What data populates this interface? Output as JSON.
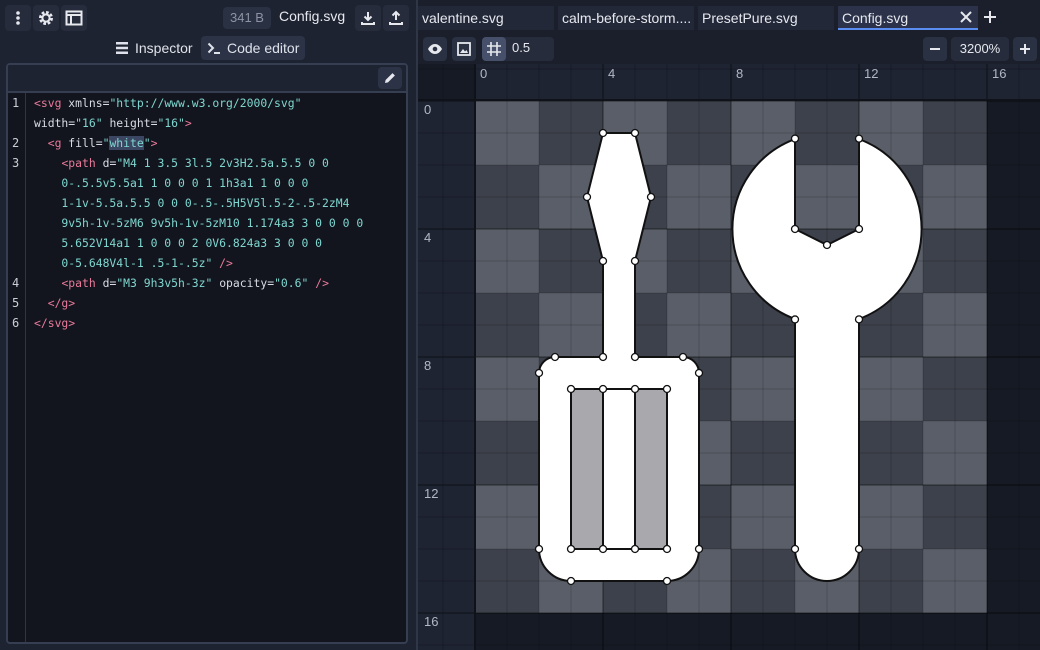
{
  "toolbar": {
    "file_size": "341 B",
    "file_name": "Config.svg"
  },
  "panel_tabs": [
    {
      "label": "Inspector",
      "icon": "layers-icon"
    },
    {
      "label": "Code editor",
      "icon": "terminal-icon"
    }
  ],
  "code": {
    "line_numbers": [
      "1",
      "2",
      "3",
      "4",
      "5",
      "6"
    ],
    "lines": [
      "<svg xmlns=\"http://www.w3.org/2000/svg\"",
      "width=\"16\" height=\"16\">",
      "  <g fill=\"white\">",
      "    <path d=\"M4 1 3.5 3l.5 2v3H2.5a.5.5 0 0",
      "    0-.5.5v5.5a1 1 0 0 0 1 1h3a1 1 0 0 0",
      "    1-1v-5.5a.5.5 0 0 0-.5-.5H5V5l.5-2-.5-2zM4",
      "    9v5h-1v-5zM6 9v5h-1v-5zM10 1.174a3 3 0 0 0 0",
      "    5.652V14a1 1 0 0 0 2 0V6.824a3 3 0 0 0",
      "    0-5.648V4l-1 .5-1-.5z\" />",
      "    <path d=\"M3 9h3v5h-3z\" opacity=\"0.6\" />",
      "  </g>",
      "</svg>"
    ]
  },
  "file_tabs": [
    {
      "label": "valentine.svg"
    },
    {
      "label": "calm-before-storm...."
    },
    {
      "label": "PresetPure.svg"
    },
    {
      "label": "Config.svg",
      "active": true
    }
  ],
  "view": {
    "snap_value": "0.5",
    "zoom": "3200%"
  },
  "ruler": {
    "x_labels": [
      "0",
      "4",
      "8",
      "12",
      "16"
    ],
    "y_labels": [
      "0",
      "4",
      "8",
      "12",
      "16"
    ]
  },
  "colors": {
    "accent": "#5b8cf0",
    "checker_light": "#5a5e68",
    "checker_dark": "#3d414b"
  }
}
